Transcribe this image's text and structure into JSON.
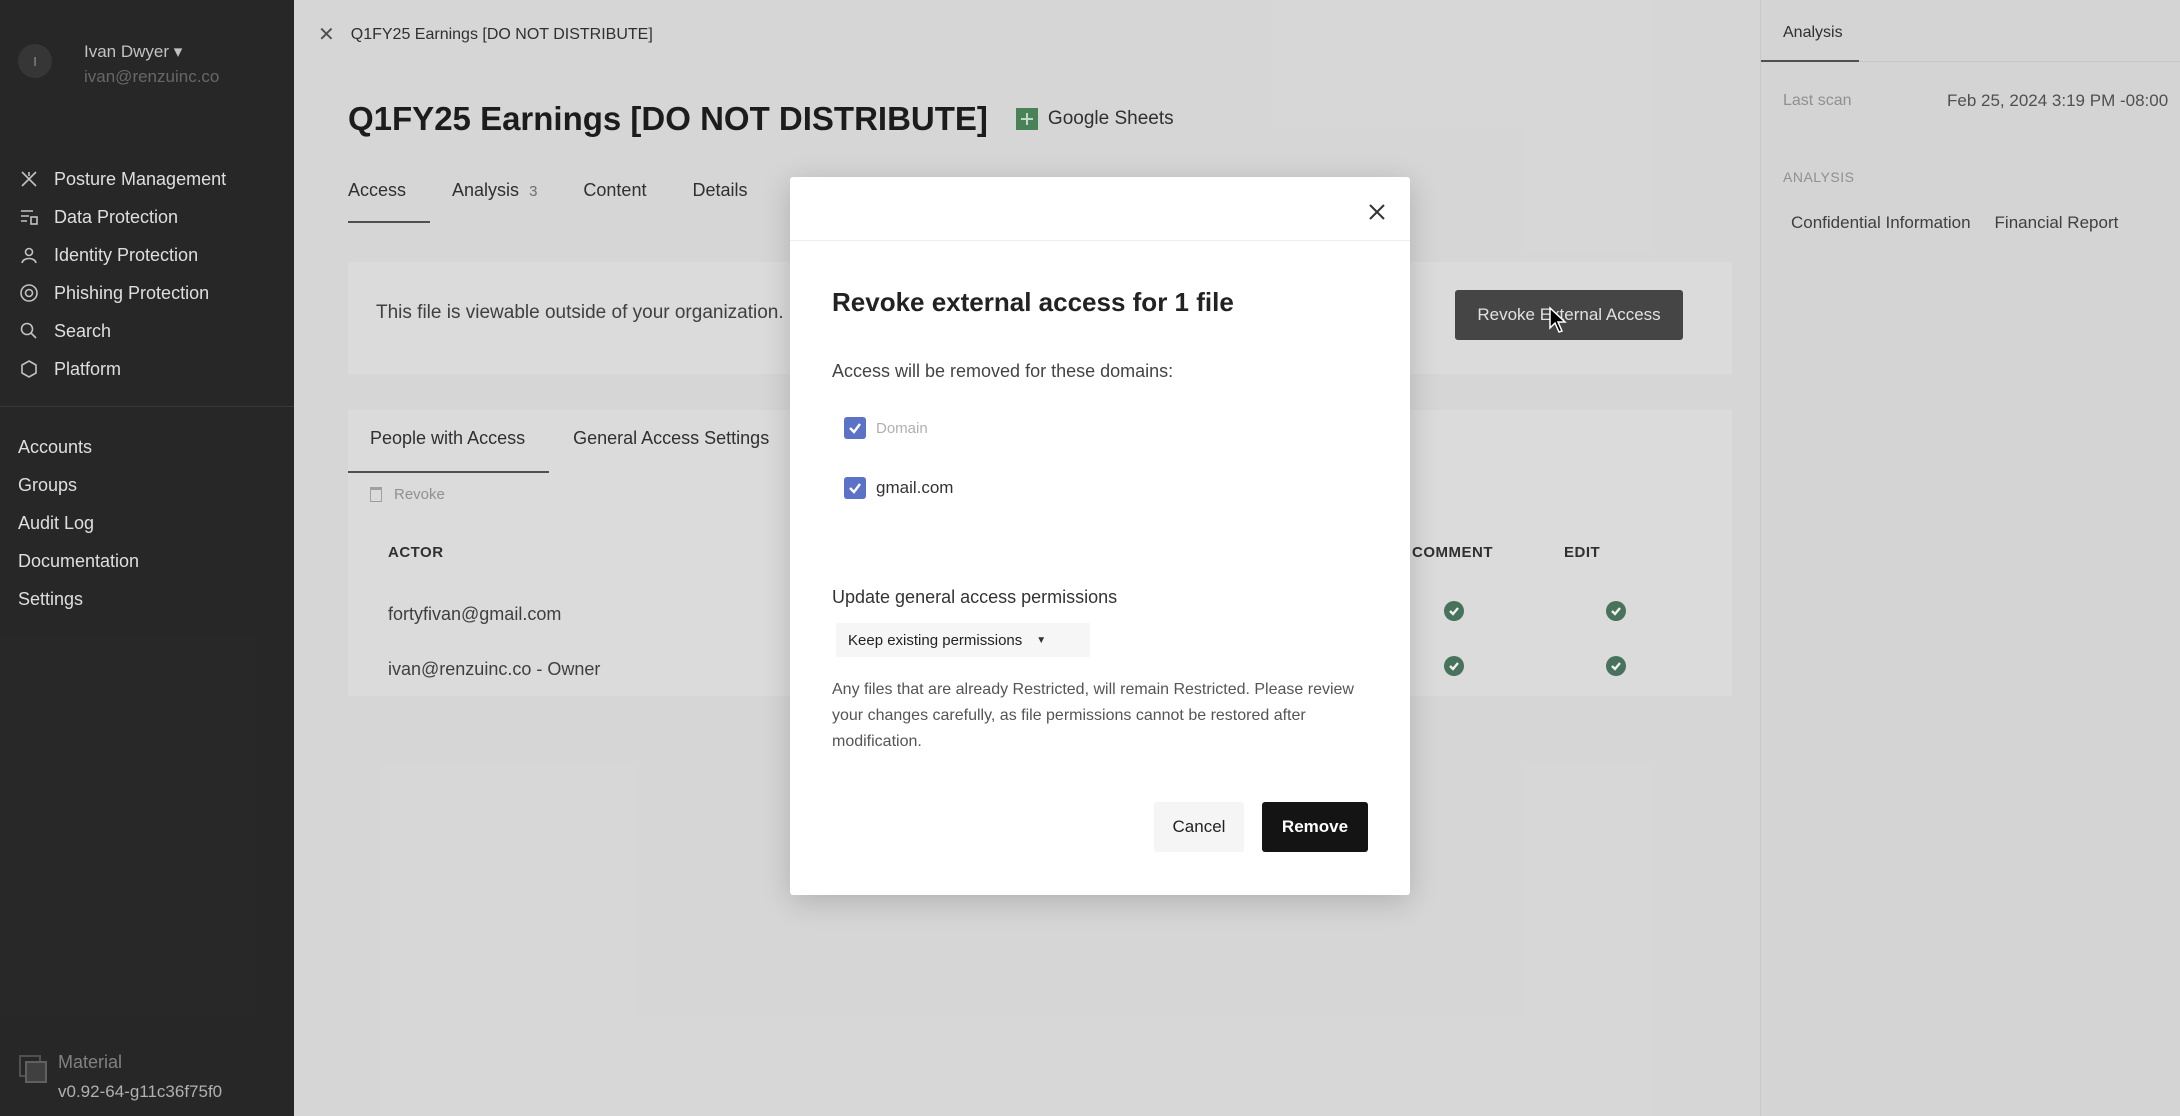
{
  "user": {
    "initial": "I",
    "name": "Ivan Dwyer",
    "email": "ivan@renzuinc.co"
  },
  "sidebar": {
    "primary": [
      {
        "label": "Posture Management",
        "icon": "posture-icon"
      },
      {
        "label": "Data Protection",
        "icon": "data-protection-icon"
      },
      {
        "label": "Identity Protection",
        "icon": "identity-icon"
      },
      {
        "label": "Phishing Protection",
        "icon": "phishing-icon"
      },
      {
        "label": "Search",
        "icon": "search-icon"
      },
      {
        "label": "Platform",
        "icon": "platform-icon"
      }
    ],
    "secondary": [
      {
        "label": "Accounts"
      },
      {
        "label": "Groups"
      },
      {
        "label": "Audit Log"
      },
      {
        "label": "Documentation"
      },
      {
        "label": "Settings"
      }
    ],
    "brand": {
      "name": "Material",
      "version": "v0.92-64-g11c36f75f0"
    }
  },
  "main": {
    "breadcrumb": "Q1FY25 Earnings [DO NOT DISTRIBUTE]",
    "title": "Q1FY25 Earnings [DO NOT DISTRIBUTE]",
    "file_type": "Google Sheets",
    "tabs": [
      {
        "label": "Access",
        "badge": ""
      },
      {
        "label": "Analysis",
        "badge": "3"
      },
      {
        "label": "Content",
        "badge": ""
      },
      {
        "label": "Details",
        "badge": ""
      }
    ],
    "external_message": "This file is viewable outside of your organization.",
    "revoke_external_button": "Revoke External Access",
    "subtabs": [
      "People with Access",
      "General Access Settings"
    ],
    "revoke_label": "Revoke",
    "table": {
      "headers": {
        "actor": "ACTOR",
        "comment": "COMMENT",
        "edit": "EDIT"
      },
      "rows": [
        {
          "actor": "fortyfivan@gmail.com",
          "comment": true,
          "edit": true
        },
        {
          "actor": "ivan@renzuinc.co - Owner",
          "comment": true,
          "edit": true
        }
      ]
    }
  },
  "right_panel": {
    "tab": "Analysis",
    "last_scan_label": "Last scan",
    "last_scan_value": "Feb 25, 2024 3:19 PM -08:00",
    "section": "ANALYSIS",
    "tags": [
      "Confidential Information",
      "Financial Report"
    ]
  },
  "modal": {
    "title": "Revoke external access for 1 file",
    "subtitle": "Access will be removed for these domains:",
    "domains": [
      {
        "label": "Domain",
        "checked": true
      },
      {
        "label": "gmail.com",
        "checked": true
      }
    ],
    "update_label": "Update general access permissions",
    "select_value": "Keep existing permissions",
    "note": "Any files that are already Restricted, will remain Restricted. Please review your changes carefully, as file permissions cannot be restored after modification.",
    "cancel": "Cancel",
    "remove": "Remove"
  },
  "colors": {
    "sidebar": "#2a2a2a",
    "checkbox": "#5b72c7",
    "check_green": "#4c7a62",
    "primary_button": "#141414"
  }
}
